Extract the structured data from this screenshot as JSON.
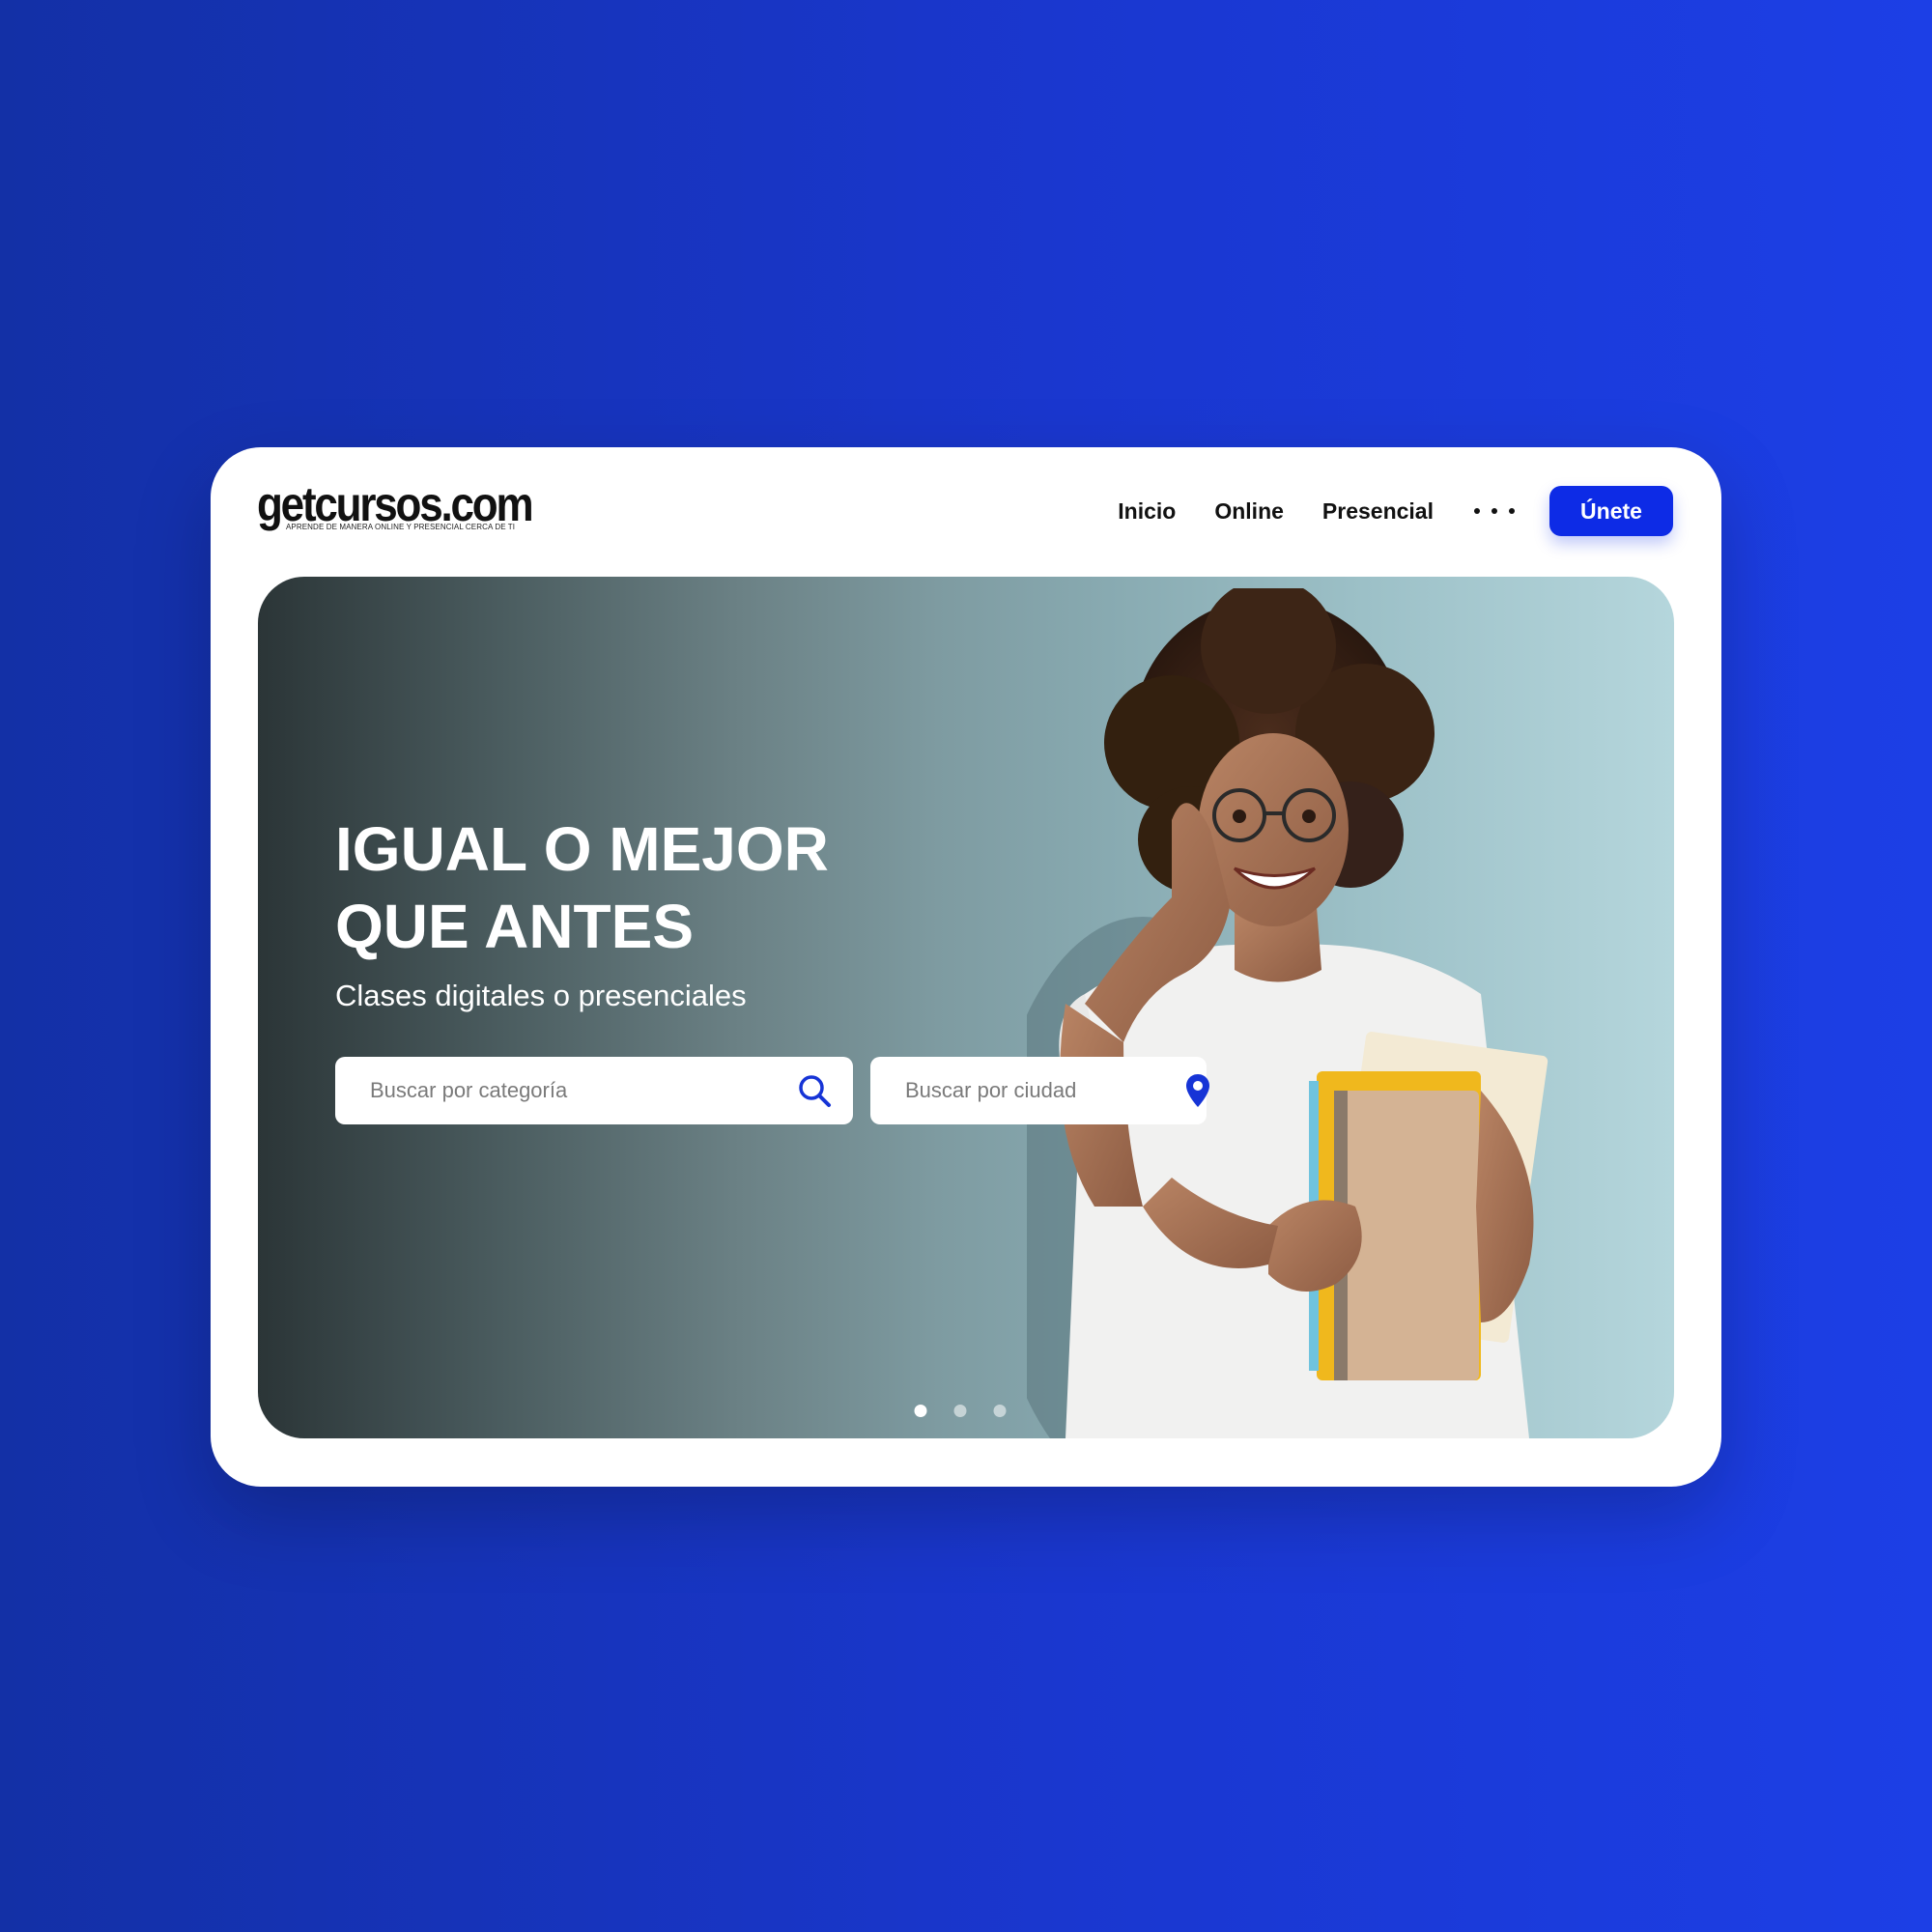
{
  "header": {
    "logo_text": "getcursos.com",
    "logo_tagline": "APRENDE DE MANERA ONLINE Y PRESENCIAL CERCA DE TI",
    "nav": [
      {
        "label": "Inicio"
      },
      {
        "label": "Online"
      },
      {
        "label": "Presencial"
      }
    ],
    "more_icon": "more-dots-icon",
    "join_label": "Únete"
  },
  "hero": {
    "title": "IGUAL O MEJOR QUE ANTES",
    "subtitle": "Clases digitales o presenciales",
    "search_category": {
      "placeholder": "Buscar por categoría",
      "value": "",
      "icon": "search-icon"
    },
    "search_city": {
      "placeholder": "Buscar por ciudad",
      "value": "",
      "icon": "location-pin-icon"
    },
    "carousel": {
      "slides": 3,
      "active": 1
    }
  },
  "colors": {
    "background": "#1a37cf",
    "accent": "#0d2be6",
    "card": "#ffffff"
  }
}
